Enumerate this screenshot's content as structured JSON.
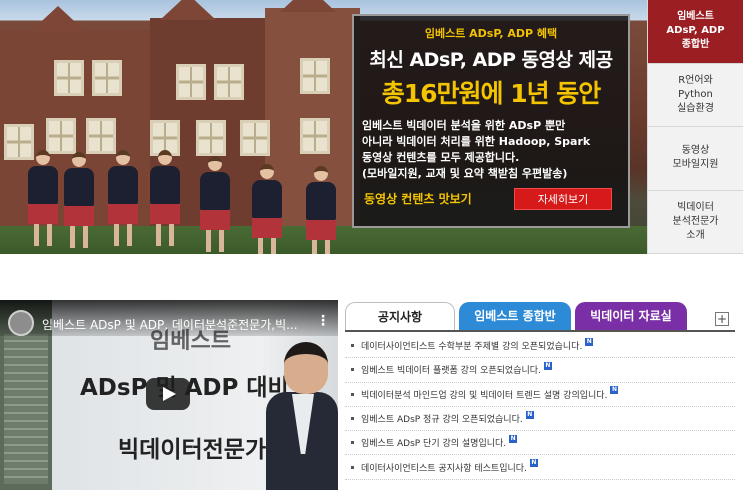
{
  "promo": {
    "tag": "임베스트 ADsP, ADP 혜택",
    "line1": "최신 ADsP, ADP 동영상 제공",
    "line2": "총16만원에 1년 동안",
    "desc_lines": [
      "임베스트 빅데이터 분석을 위한 ADsP 뿐만",
      "아니라 빅데이터 처리를 위한 Hadoop, Spark",
      "동영상 컨텐츠를 모두 제공합니다.",
      "(모바일지원, 교재 및 요약 책받침 우편발송)"
    ],
    "footer": "동영상 컨텐츠 맛보기",
    "button": "자세히보기"
  },
  "side_menu": [
    {
      "label": "임베스트\nADsP, ADP\n종합반",
      "active": true
    },
    {
      "label": "R언어와\nPython\n실습환경",
      "active": false
    },
    {
      "label": "동영상\n모바일지원",
      "active": false
    },
    {
      "label": "빅데이터\n분석전문가\n소개",
      "active": false
    }
  ],
  "video": {
    "title": "임베스트 ADsP 및 ADP, 데이터분석준전문가,빅...",
    "menu_icon": "⋮",
    "text1": "임베스트",
    "text2": "ADsP 및 ADP 대비",
    "text3": "빅데이터전문가"
  },
  "board": {
    "tabs": [
      "공지사항",
      "임베스트 종합반",
      "빅데이터 자료실"
    ],
    "more": "+",
    "notices": [
      "데이터사이언티스트 수학부분 주제별 강의 오픈되었습니다.",
      "임베스트 빅데이터 플랫폼 강의 오픈되었습니다.",
      "빅데이터분석 마인드업 강의 및 빅데이터 트렌드 설명 강의입니다.",
      "임베스트 ADsP 정규 강의 오픈되었습니다.",
      "임베스트 ADsP 단기 강의 설명입니다.",
      "데이터사이언티스트 공지사항 테스트입니다."
    ],
    "new_badge": "N"
  },
  "colors": {
    "accent_red": "#9b1e23",
    "tab_blue": "#2c8ad6",
    "tab_purple": "#7a2fa6",
    "promo_yellow": "#f5c400"
  }
}
